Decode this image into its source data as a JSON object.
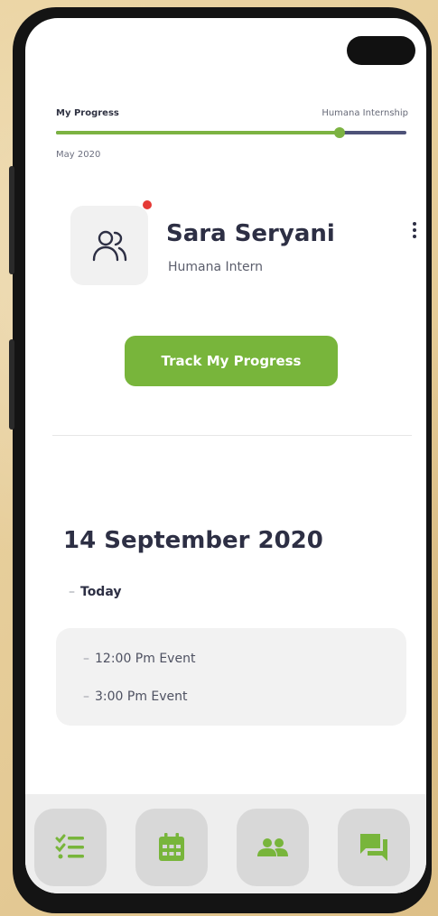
{
  "progress": {
    "title": "My Progress",
    "program": "Humana Internship",
    "date": "May 2020",
    "value": 0.81
  },
  "profile": {
    "name": "Sara Seryani",
    "role": "Humana Intern",
    "has_notification": true
  },
  "actions": {
    "track_label": "Track My Progress"
  },
  "schedule": {
    "date": "14 September 2020",
    "day_label": "Today",
    "events": [
      "12:00 Pm Event",
      "3:00 Pm Event"
    ]
  },
  "nav": {
    "items": [
      "tasks-icon",
      "calendar-icon",
      "people-icon",
      "chat-icon"
    ]
  },
  "colors": {
    "accent": "#78b53b",
    "text": "#2d2f44",
    "bar_track": "#4d5278",
    "notification": "#e53935"
  }
}
